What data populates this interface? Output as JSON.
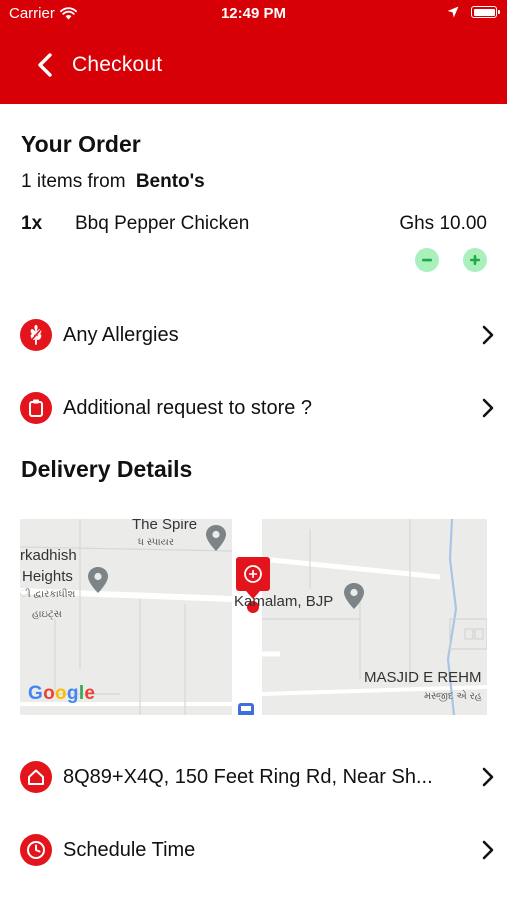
{
  "status_bar": {
    "carrier": "Carrier",
    "time": "12:49 PM"
  },
  "nav": {
    "title": "Checkout",
    "back_icon": "chevron-left-icon"
  },
  "order": {
    "heading": "Your Order",
    "from_prefix": "1 items from",
    "store_name": "Bento's",
    "items": [
      {
        "qty": "1x",
        "name": "Bbq Pepper Chicken",
        "price": "Ghs 10.00"
      }
    ]
  },
  "options": {
    "allergies": {
      "label": "Any Allergies",
      "icon": "wheat-icon"
    },
    "request": {
      "label": "Additional request to store ?",
      "icon": "notepad-icon"
    }
  },
  "delivery": {
    "heading": "Delivery Details",
    "map": {
      "labels": {
        "spire": "The Spire",
        "spire_local": "ધ સ્પાયર",
        "heights_1": "rkadhish",
        "heights_2": "Heights",
        "heights_local_1": "ી દ્વારકાધીશ",
        "heights_local_2": "હાઇટ્સ",
        "kamalam": "Kamalam, BJP",
        "masjid": "MASJID E REHM",
        "masjid_local": "મસ્જીદ એ રહ"
      },
      "logo": "Google"
    },
    "address": {
      "label": "8Q89+X4Q, 150 Feet Ring Rd, Near Sh...",
      "icon": "home-icon"
    },
    "schedule": {
      "label": "Schedule Time",
      "icon": "clock-icon"
    }
  },
  "colors": {
    "brand": "#d70007",
    "icon_red": "#e4141d",
    "qty_button": "#a9f0bd",
    "qty_icon": "#1faa4a"
  }
}
